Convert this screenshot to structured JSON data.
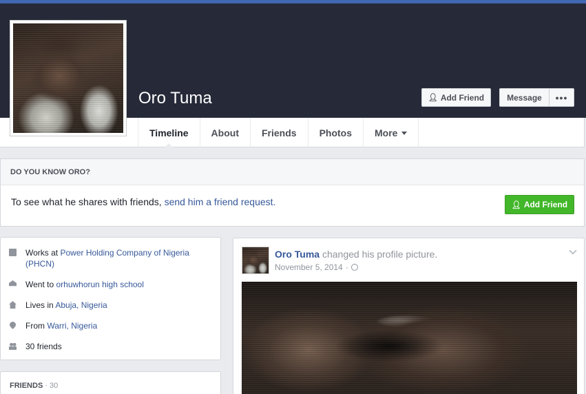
{
  "profile": {
    "name": "Oro Tuma"
  },
  "header_buttons": {
    "add_friend": "Add Friend",
    "message": "Message",
    "more": "•••"
  },
  "tabs": [
    {
      "label": "Timeline"
    },
    {
      "label": "About"
    },
    {
      "label": "Friends"
    },
    {
      "label": "Photos"
    },
    {
      "label": "More"
    }
  ],
  "know_card": {
    "title": "DO YOU KNOW ORO?",
    "text": "To see what he shares with friends, ",
    "link": "send him a friend request.",
    "button": "Add Friend"
  },
  "intro": {
    "items": [
      {
        "icon": "briefcase-icon",
        "prefix": "Works at ",
        "link": "Power Holding Company of Nigeria (PHCN)"
      },
      {
        "icon": "graduation-cap-icon",
        "prefix": "Went to ",
        "link": "orhuwhorun high school"
      },
      {
        "icon": "home-icon",
        "prefix": "Lives in ",
        "link": "Abuja, Nigeria"
      },
      {
        "icon": "location-pin-icon",
        "prefix": "From ",
        "link": "Warri, Nigeria"
      },
      {
        "icon": "friends-icon",
        "prefix": "30 friends",
        "link": ""
      }
    ]
  },
  "friends_card": {
    "title": "FRIENDS",
    "count": " · 30"
  },
  "post": {
    "author": "Oro Tuma",
    "action": " changed his profile picture.",
    "date": "November 5, 2014",
    "separator": "·"
  },
  "colors": {
    "brand": "#4267b2",
    "cover": "#262a38",
    "link": "#365899",
    "green": "#42b72a"
  }
}
